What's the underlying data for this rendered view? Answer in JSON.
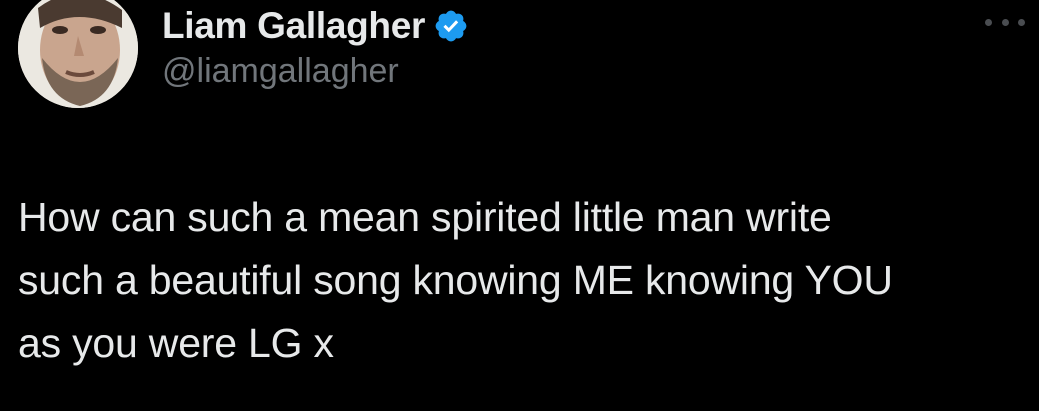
{
  "author": {
    "display_name": "Liam Gallagher",
    "handle": "@liamgallagher",
    "verified": true,
    "verified_color": "#1d9bf0"
  },
  "tweet": {
    "lines": [
      "How can such a mean spirited little man write",
      "such a beautiful song knowing ME knowing YOU",
      "as you were LG x"
    ]
  },
  "icons": {
    "avatar": "profile-photo",
    "verified": "verified-badge-icon",
    "more": "more-options-icon"
  },
  "colors": {
    "background": "#000000",
    "primary_text": "#e7e9ea",
    "secondary_text": "#71767b"
  }
}
